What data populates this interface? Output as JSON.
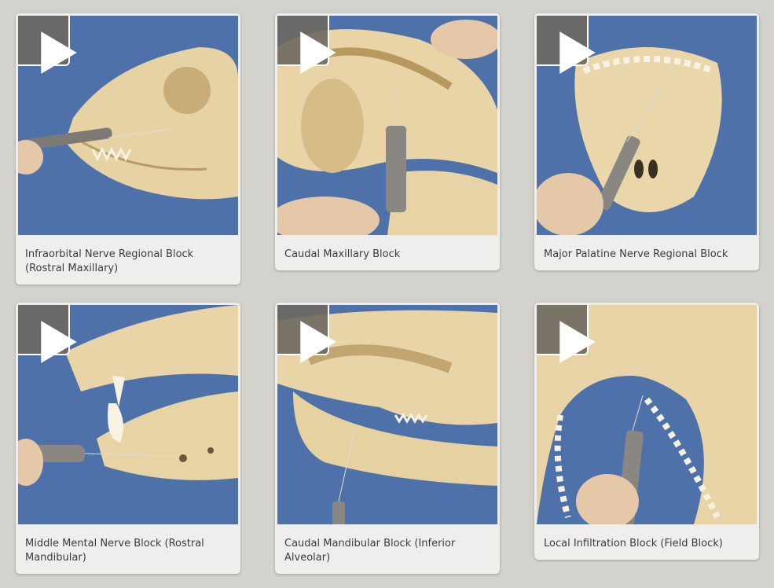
{
  "colors": {
    "page_background": "#d3d2cd",
    "card_background": "#efeeec",
    "drape_blue": "#4d6fa8",
    "bone": "#e9d5a8",
    "play_overlay": "#6e6860"
  },
  "videos": [
    {
      "title": "Infraorbital Nerve Regional Block (Rostral Maxillary)",
      "icon": "play-icon"
    },
    {
      "title": "Caudal Maxillary Block",
      "icon": "play-icon"
    },
    {
      "title": "Major Palatine Nerve Regional Block",
      "icon": "play-icon"
    },
    {
      "title": "Middle Mental Nerve Block (Rostral Mandibular)",
      "icon": "play-icon"
    },
    {
      "title": "Caudal Mandibular Block (Inferior Alveolar)",
      "icon": "play-icon"
    },
    {
      "title": "Local Infiltration Block (Field Block)",
      "icon": "play-icon"
    }
  ]
}
